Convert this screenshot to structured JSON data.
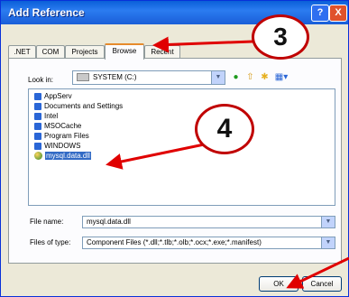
{
  "window": {
    "title": "Add Reference",
    "help_label": "?",
    "close_label": "X"
  },
  "tabs": [
    {
      "label": ".NET"
    },
    {
      "label": "COM"
    },
    {
      "label": "Projects"
    },
    {
      "label": "Browse",
      "active": true
    },
    {
      "label": "Recent"
    }
  ],
  "lookin": {
    "label": "Look in:",
    "value": "SYSTEM (C:)"
  },
  "toolbar_icons": [
    "back-icon",
    "up-folder-icon",
    "new-folder-icon",
    "views-icon"
  ],
  "files": [
    {
      "name": "AppServ",
      "type": "folder"
    },
    {
      "name": "Documents and Settings",
      "type": "folder"
    },
    {
      "name": "Intel",
      "type": "folder"
    },
    {
      "name": "MSOCache",
      "type": "folder"
    },
    {
      "name": "Program Files",
      "type": "folder"
    },
    {
      "name": "WINDOWS",
      "type": "folder"
    },
    {
      "name": "mysql.data.dll",
      "type": "file",
      "selected": true
    }
  ],
  "filename": {
    "label": "File name:",
    "value": "mysql.data.dll"
  },
  "filetype": {
    "label": "Files of type:",
    "value": "Component Files (*.dll;*.tlb;*.olb;*.ocx;*.exe;*.manifest)"
  },
  "buttons": {
    "ok": "OK",
    "cancel": "Cancel"
  },
  "annotations": {
    "step3": "3",
    "step4": "4"
  },
  "colors": {
    "titlebar": "#0a5fd8",
    "selection": "#316ac5",
    "annotation": "#e00000"
  }
}
